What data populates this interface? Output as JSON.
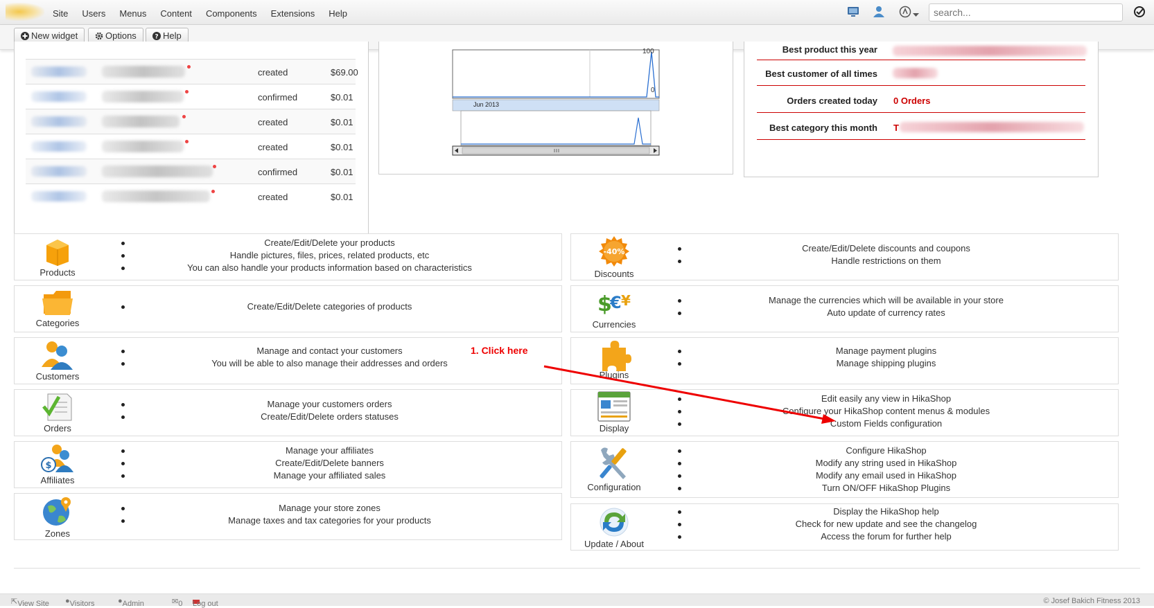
{
  "navbar": {
    "menu": [
      "Site",
      "Users",
      "Menus",
      "Content",
      "Components",
      "Extensions",
      "Help"
    ],
    "search_placeholder": "search...",
    "icons": [
      "monitor-icon",
      "user-icon",
      "joomla-icon",
      "chevron-down-icon",
      "checkmark-circle-icon"
    ]
  },
  "toolbar": {
    "new_widget": "New widget",
    "options": "Options",
    "help": "Help"
  },
  "orders": [
    {
      "status": "created",
      "price": "$69.00"
    },
    {
      "status": "confirmed",
      "price": "$0.01"
    },
    {
      "status": "created",
      "price": "$0.01"
    },
    {
      "status": "created",
      "price": "$0.01"
    },
    {
      "status": "confirmed",
      "price": "$0.01"
    },
    {
      "status": "created",
      "price": "$0.01"
    }
  ],
  "chart": {
    "date_label": "Jun 2013",
    "y_top": "100",
    "y_bottom": "0"
  },
  "stats": [
    {
      "label": "Best product this year",
      "value": ""
    },
    {
      "label": "Best customer of all times",
      "value": ""
    },
    {
      "label": "Orders created today",
      "value": "0 Orders"
    },
    {
      "label": "Best category this month",
      "value": "T"
    }
  ],
  "features": {
    "products": {
      "label": "Products",
      "items": [
        "Create/Edit/Delete your products",
        "Handle pictures, files, prices, related products, etc",
        "You can also handle your products information based on characteristics"
      ]
    },
    "categories": {
      "label": "Categories",
      "items": [
        "Create/Edit/Delete categories of products"
      ]
    },
    "customers": {
      "label": "Customers",
      "items": [
        "Manage and contact your customers",
        "You will be able to also manage their addresses and orders"
      ]
    },
    "orders": {
      "label": "Orders",
      "items": [
        "Manage your customers orders",
        "Create/Edit/Delete orders statuses"
      ]
    },
    "affiliates": {
      "label": "Affiliates",
      "items": [
        "Manage your affiliates",
        "Create/Edit/Delete banners",
        "Manage your affiliated sales"
      ]
    },
    "zones": {
      "label": "Zones",
      "items": [
        "Manage your store zones",
        "Manage taxes and tax categories for your products"
      ]
    },
    "discounts": {
      "label": "Discounts",
      "badge": "-40%",
      "items": [
        "Create/Edit/Delete discounts and coupons",
        "Handle restrictions on them"
      ]
    },
    "currencies": {
      "label": "Currencies",
      "items": [
        "Manage the currencies which will be available in your store",
        "Auto update of currency rates"
      ]
    },
    "plugins": {
      "label": "Plugins",
      "items": [
        "Manage payment plugins",
        "Manage shipping plugins"
      ]
    },
    "display": {
      "label": "Display",
      "items": [
        "Edit easily any view in HikaShop",
        "Configure your HikaShop content menus & modules",
        "Custom Fields configuration"
      ]
    },
    "configuration": {
      "label": "Configuration",
      "items": [
        "Configure HikaShop",
        "Modify any string used in HikaShop",
        "Modify any email used in HikaShop",
        "Turn ON/OFF HikaShop Plugins"
      ]
    },
    "update": {
      "label": "Update / About",
      "items": [
        "Display the HikaShop help",
        "Check for new update and see the changelog",
        "Access the forum for further help"
      ]
    }
  },
  "annotation": "1. Click here",
  "statusbar": {
    "view_site": "View Site",
    "visitors": "Visitors",
    "admin": "Admin",
    "messages_count": "0",
    "logout": "Log out",
    "copyright": "© Josef Bakich Fitness 2013"
  }
}
